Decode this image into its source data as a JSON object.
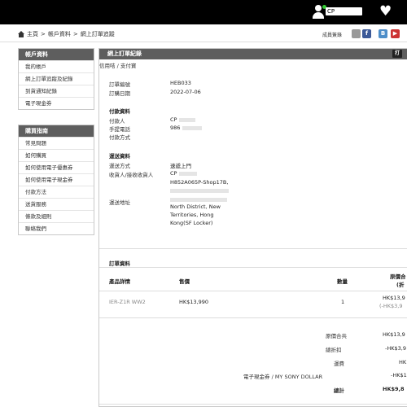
{
  "topbar": {
    "username": "CP",
    "heart_icon": "heart-icon",
    "user_icon": "user-icon"
  },
  "breadcrumb": {
    "items": [
      "主頁",
      ">",
      "帳戶資料",
      ">",
      "網上訂單追蹤"
    ]
  },
  "header_right": {
    "vip_label": "成員簽錄",
    "social": [
      "f",
      "B",
      "▶"
    ]
  },
  "account_box": {
    "title": "帳戶資料",
    "items": [
      "我的帳戶",
      "網上訂單追蹤及紀錄",
      "到貨通知紀錄",
      "電子現金券"
    ]
  },
  "guide_box": {
    "title": "購買指南",
    "items": [
      "常見問題",
      "如何購買",
      "如何使用電子優惠券",
      "如何使用電子現金券",
      "付款方法",
      "送貨服務",
      "條款及細則",
      "聯絡我們"
    ]
  },
  "main": {
    "title": "網上訂單紀錄",
    "print_label": "打",
    "subcrumb": "信用咭 / 支付寶",
    "order": {
      "no_label": "訂單編號",
      "no_value": "HEB033",
      "date_label": "訂購日期",
      "date_value": "2022-07-06"
    },
    "payment": {
      "section": "付款資料",
      "payer_label": "付款人",
      "payer_value": "CP",
      "phone_label": "手提電話",
      "phone_value": "986",
      "method_label": "付款方式"
    },
    "delivery": {
      "section": "運送資料",
      "method_label": "運送方式",
      "method_value": "速遞上門",
      "receiver_label": "收貨人/接收收貨人",
      "receiver_value": "CP",
      "receiver_line2": "H852A065P-Shop17B,",
      "address_label": "運送地址",
      "address_line1": "North District, New",
      "address_line2": "Territories, Hong",
      "address_line3": "Kong(SF Locker)"
    },
    "items_section": "訂單資料",
    "table_headers": {
      "product": "產品詳情",
      "price": "售價",
      "qty": "數量",
      "orig": "原價合",
      "orig2": "(折"
    },
    "row": {
      "name": "IER-Z1R WW2",
      "price": "HK$13,990",
      "qty": "1",
      "total": "HK$13,9",
      "discount": "(-HK$3,9"
    },
    "summary": [
      {
        "label": "原價合共",
        "value": "HK$13,9"
      },
      {
        "label": "總折扣",
        "value": "-HK$3,9"
      },
      {
        "label": "運費",
        "value": "HK"
      },
      {
        "label": "電子現金券 / MY SONY DOLLAR",
        "value": "-HK$1"
      },
      {
        "label": "總計",
        "value": "HK$9,8"
      }
    ]
  }
}
